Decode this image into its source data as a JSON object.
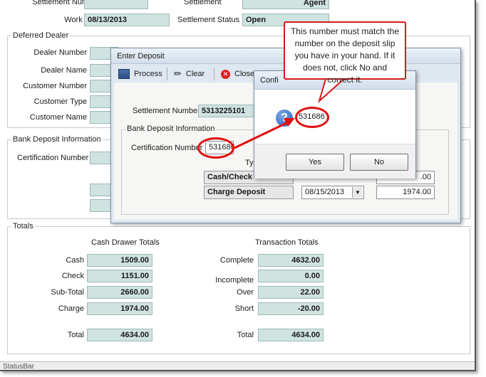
{
  "main": {
    "settlement_number_label": "Settlement Number",
    "settlement_label_partial": "Settlement",
    "settlement_value_partial": "Agent",
    "work_date_label": "Work Date",
    "work_date_value": "08/13/2013",
    "settlement_status_label": "Settlement Status",
    "settlement_status_value": "Open",
    "status_bar_text": "StatusBar"
  },
  "deferred_dealer": {
    "legend": "Deferred Dealer",
    "dealer_number_label": "Dealer Number",
    "dealer_name_label": "Dealer Name",
    "customer_number_label": "Customer Number",
    "customer_type_label": "Customer Type",
    "customer_name_label": "Customer Name"
  },
  "bank_deposit": {
    "legend": "Bank Deposit Information",
    "certification_number_label": "Certification Number"
  },
  "totals": {
    "legend": "Totals",
    "cash_drawer_header": "Cash Drawer Totals",
    "transaction_header": "Transaction Totals",
    "cash_label": "Cash",
    "cash_value": "1509.00",
    "check_label": "Check",
    "check_value": "1151.00",
    "subtotal_label": "Sub-Total",
    "subtotal_value": "2660.00",
    "charge_label": "Charge",
    "charge_value": "1974.00",
    "drawer_total_label": "Total",
    "drawer_total_value": "4634.00",
    "complete_label": "Complete",
    "complete_value": "4632.00",
    "incomplete_label": "Incomplete",
    "incomplete_value": "0.00",
    "over_label": "Over",
    "over_value": "22.00",
    "short_label": "Short",
    "short_value": "-20.00",
    "transaction_total_label": "Total",
    "transaction_total_value": "4634.00"
  },
  "enter_deposit": {
    "title": "Enter Deposit",
    "toolbar": {
      "process": "Process",
      "clear": "Clear",
      "close": "Close"
    },
    "settlement_number_label": "Settlement Number",
    "settlement_number_value": "5313225101",
    "bank_deposit_legend": "Bank Deposit Information",
    "certification_number_label": "Certification Number",
    "certification_number_value": "531686",
    "type_label": "Type",
    "cash_check_label": "Cash/Check",
    "cash_check_amount_partial": ".00",
    "charge_deposit_label": "Charge Deposit",
    "charge_deposit_date": "08/15/2013",
    "charge_deposit_amount": "1974.00"
  },
  "confirm": {
    "title_partial": "Confi",
    "value": "531686",
    "yes_label": "Yes",
    "no_label": "No"
  },
  "callout": {
    "text": "This number must match the number on the deposit slip you have in your hand.  If it does not, click No and correct it."
  },
  "colors": {
    "field_bg": "#cfe3e1",
    "annotation_red": "#e01010",
    "dialog_bg": "#dfe7f0",
    "question_icon_blue": "#2a5fb8"
  }
}
